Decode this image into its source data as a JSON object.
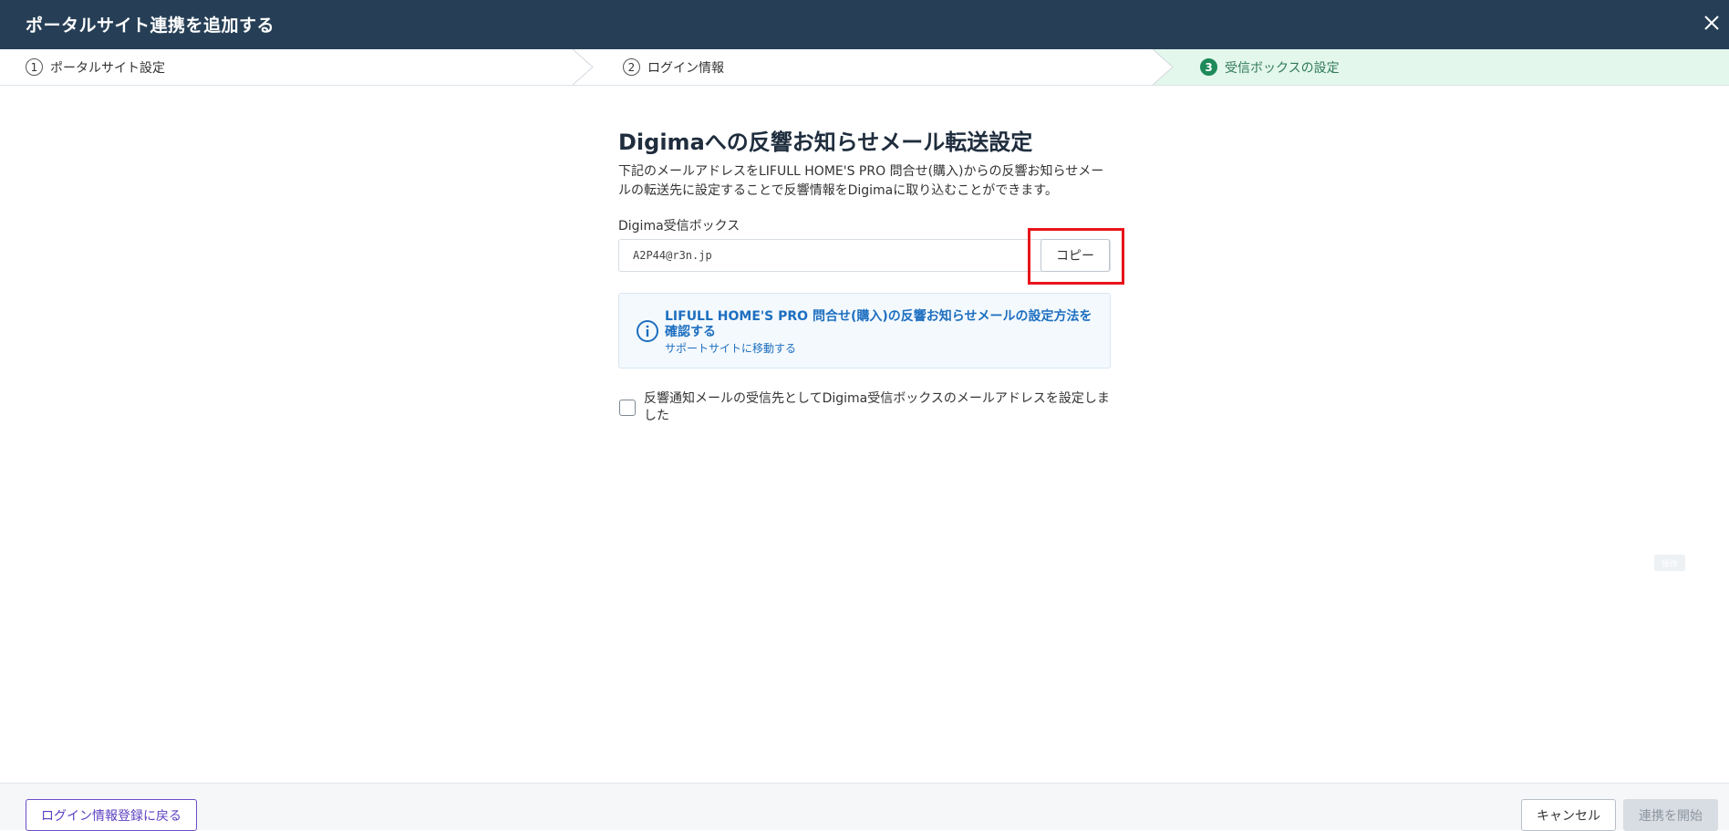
{
  "header": {
    "title": "ポータルサイト連携を追加する",
    "close_icon": "close-icon"
  },
  "steps": [
    {
      "number": "1",
      "label": "ポータルサイト設定",
      "state": "done"
    },
    {
      "number": "2",
      "label": "ログイン情報",
      "state": "done"
    },
    {
      "number": "3",
      "label": "受信ボックスの設定",
      "state": "active"
    }
  ],
  "main": {
    "title": "Digimaへの反響お知らせメール転送設定",
    "description": "下記のメールアドレスをLIFULL HOME'S PRO 問合せ(購入)からの反響お知らせメールの転送先に設定することで反響情報をDigimaに取り込むことができます。",
    "inbox_label": "Digima受信ボックス",
    "inbox_email": "A2P44@r3n.jp",
    "copy_label": "コピー",
    "info_link": "LIFULL HOME'S PRO 問合せ(購入)の反響お知らせメールの設定方法を確認する",
    "info_sub": "サポートサイトに移動する",
    "info_icon": "info-icon",
    "checkbox_label": "反響通知メールの受信先としてDigima受信ボックスのメールアドレスを設定しました",
    "checkbox_checked": false
  },
  "faint_badge": "操作",
  "footer": {
    "back_label": "ログイン情報登録に戻る",
    "cancel_label": "キャンセル",
    "start_label": "連携を開始"
  },
  "colors": {
    "header_bg": "#263f56",
    "active_step_bg": "#e4f7ec",
    "active_step_accent": "#1e8a5a",
    "link": "#1d6fc0",
    "back_button": "#6c4fc7",
    "highlight": "#e8141b"
  }
}
